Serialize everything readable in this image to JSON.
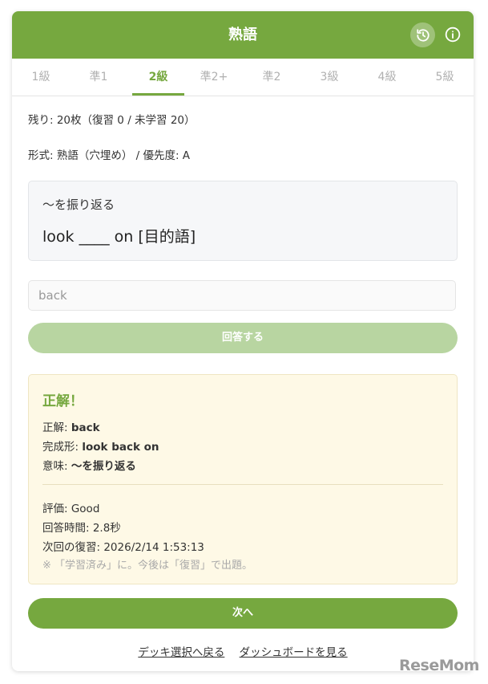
{
  "header": {
    "title": "熟語",
    "history_icon": "history-icon",
    "info_icon": "info-icon",
    "color": "#76a83f"
  },
  "tabs": [
    {
      "label": "1級",
      "active": false
    },
    {
      "label": "準1",
      "active": false
    },
    {
      "label": "2級",
      "active": true
    },
    {
      "label": "準2+",
      "active": false
    },
    {
      "label": "準2",
      "active": false
    },
    {
      "label": "3級",
      "active": false
    },
    {
      "label": "4級",
      "active": false
    },
    {
      "label": "5級",
      "active": false
    }
  ],
  "status": {
    "remaining": "残り: 20枚（復習 0 / 未学習 20）",
    "format": "形式: 熟語（穴埋め） / 優先度: A"
  },
  "question": {
    "meaning": "〜を振り返る",
    "phrase": "look ____ on [目的語]"
  },
  "answer_input": {
    "value": "back"
  },
  "submit_label": "回答する",
  "result": {
    "title": "正解！",
    "correct_label": "正解: ",
    "correct_value": "back",
    "complete_label": "完成形: ",
    "complete_value": "look back on",
    "meaning_label": "意味: ",
    "meaning_value": "〜を振り返る",
    "rating": "評価: Good",
    "answer_time": "回答時間: 2.8秒",
    "next_review": "次回の復習: 2026/2/14 1:53:13",
    "note": "※ 「学習済み」に。今後は「復習」で出題。"
  },
  "next_label": "次へ",
  "footer": {
    "back_to_decks": "デッキ選択へ戻る",
    "dashboard": "ダッシュボードを見る"
  },
  "watermark": "ReseMom"
}
